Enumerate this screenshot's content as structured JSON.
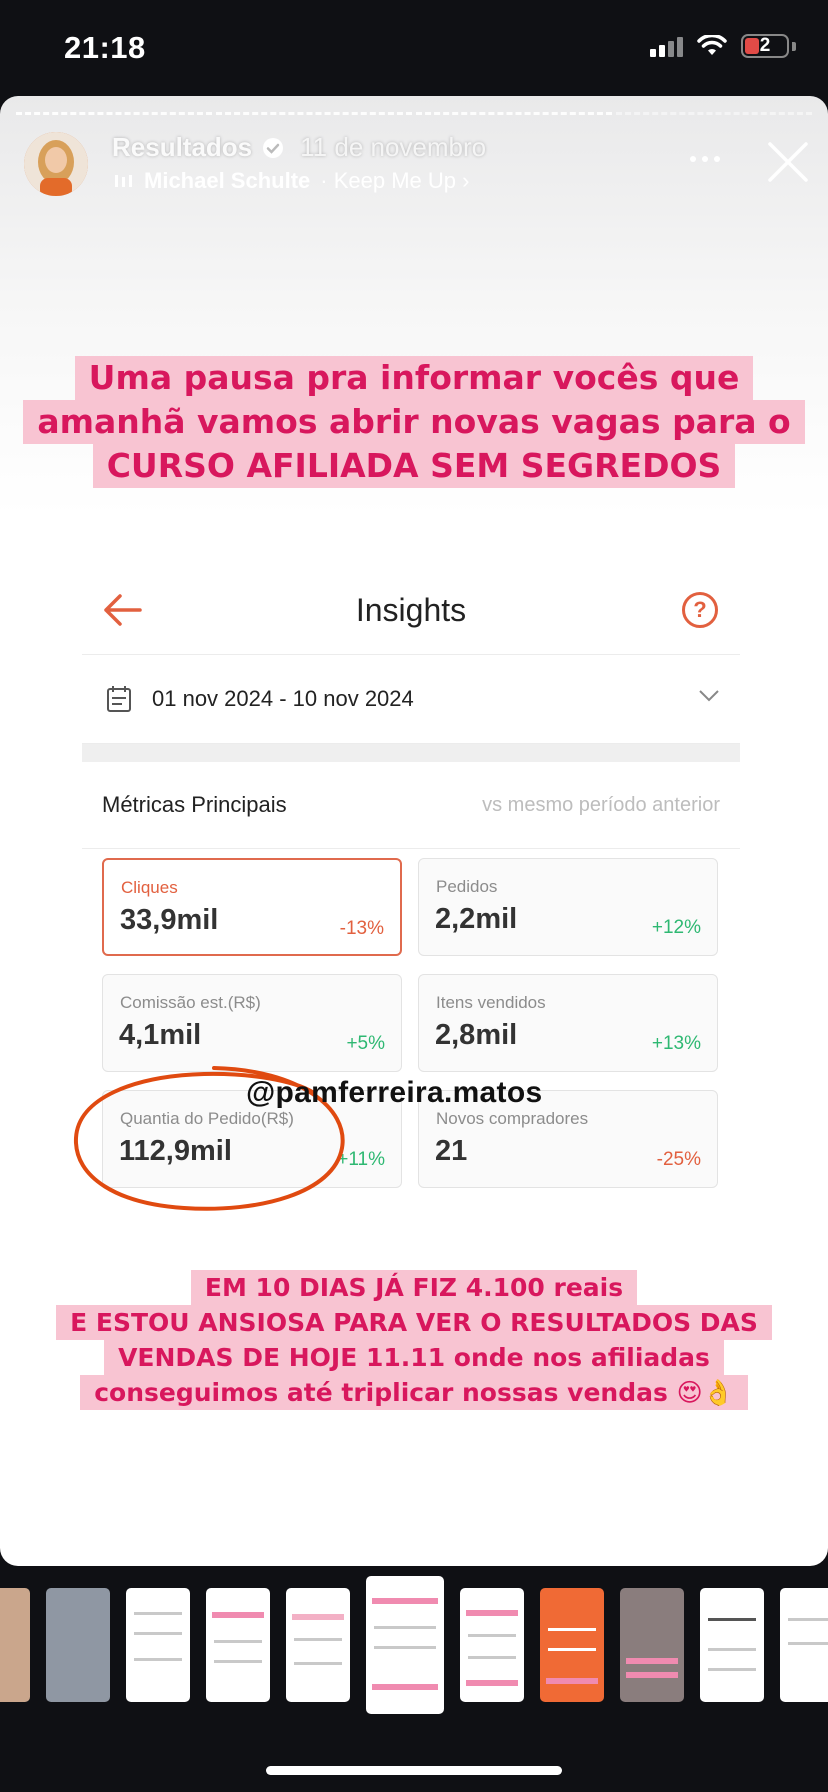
{
  "status_bar": {
    "time": "21:18",
    "battery": "2"
  },
  "story": {
    "username": "Resultados",
    "date": "11 de novembro",
    "music_artist": "Michael Schulte",
    "music_song": "· Keep Me Up ›"
  },
  "caption_top": [
    "Uma pausa pra informar vocês que",
    "amanhã vamos abrir novas vagas para o",
    "CURSO AFILIADA SEM SEGREDOS"
  ],
  "insights": {
    "title": "Insights",
    "date_range": "01 nov 2024 - 10 nov 2024",
    "section_title": "Métricas Principais",
    "comparison": "vs mesmo período anterior",
    "metrics": [
      {
        "label": "Cliques",
        "value": "33,9mil",
        "delta": "-13%"
      },
      {
        "label": "Pedidos",
        "value": "2,2mil",
        "delta": "+12%"
      },
      {
        "label": "Comissão est.(R$)",
        "value": "4,1mil",
        "delta": "+5%"
      },
      {
        "label": "Itens vendidos",
        "value": "2,8mil",
        "delta": "+13%"
      },
      {
        "label": "Quantia do Pedido(R$)",
        "value": "112,9mil",
        "delta": "+11%"
      },
      {
        "label": "Novos compradores",
        "value": "21",
        "delta": "-25%"
      }
    ]
  },
  "watermark": "@pamferreira.matos",
  "caption_bottom": [
    "EM 10 DIAS JÁ FIZ 4.100 reais",
    "E ESTOU ANSIOSA PARA VER O RESULTADOS DAS",
    "VENDAS DE HOJE 11.11 onde nos afiliadas",
    "conseguimos até triplicar nossas vendas 😍👌"
  ],
  "colors": {
    "caption_text": "#d8175d",
    "caption_bg": "#f8c4d2",
    "accent": "#e2603f",
    "positive": "#2eb872"
  },
  "icons": [
    "verified-icon",
    "music-bars-icon",
    "more-icon",
    "close-icon",
    "back-arrow-icon",
    "help-icon",
    "calendar-icon",
    "chevron-down-icon"
  ]
}
